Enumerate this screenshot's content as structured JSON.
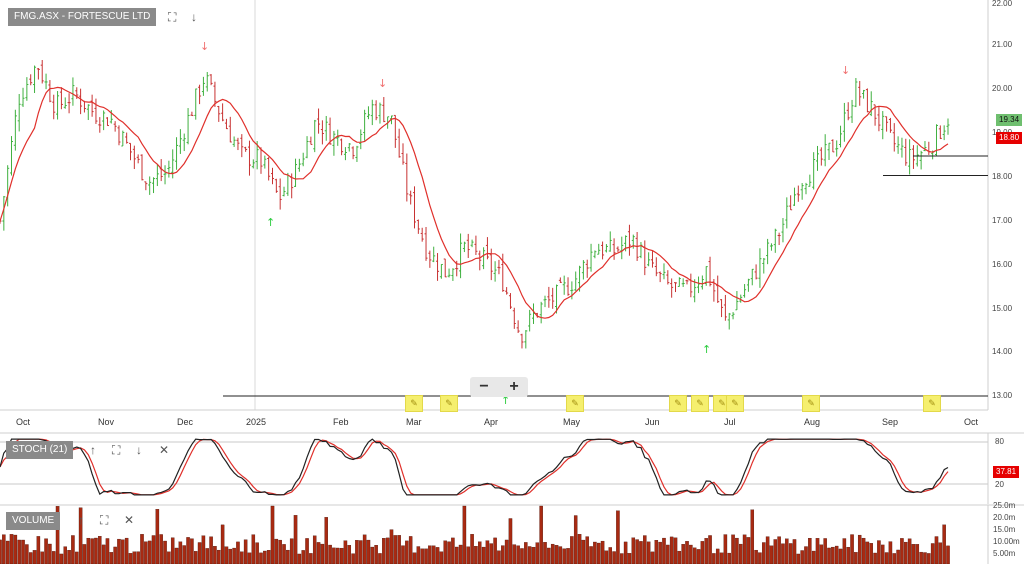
{
  "main_panel": {
    "label": "FMG.ASX - FORTESCUE LTD",
    "icons": [
      "expand-icon",
      "arrow-down-icon"
    ]
  },
  "stoch_panel": {
    "label": "STOCH (21)",
    "value_tag": "37.81",
    "icons": [
      "arrow-up-icon",
      "expand-icon",
      "arrow-down-icon",
      "close-icon"
    ],
    "axis_ticks": [
      "80",
      "20"
    ]
  },
  "volume_panel": {
    "label": "VOLUME",
    "icons": [
      "arrow-up-icon",
      "expand-icon",
      "close-icon"
    ],
    "axis_ticks": [
      "25.0m",
      "20.0m",
      "15.0m",
      "10.00m",
      "5.00m"
    ]
  },
  "price_axis": {
    "ticks": [
      "22.00",
      "21.00",
      "20.00",
      "19.00",
      "18.00",
      "17.00",
      "16.00",
      "15.00",
      "14.00",
      "13.00"
    ],
    "last_price": "19.34",
    "ma_price": "18.80"
  },
  "x_axis": {
    "months": [
      "Oct",
      "Nov",
      "Dec",
      "2025",
      "Feb",
      "Mar",
      "Apr",
      "May",
      "Jun",
      "Jul",
      "Aug",
      "Sep",
      "Oct"
    ]
  },
  "zoom": {
    "minus": "−",
    "plus": "+"
  },
  "colors": {
    "up_bar": "#3fb03f",
    "down_bar": "#c83232",
    "ma_line": "#e0302b",
    "volume_bar": "#a82a12",
    "stoch_k": "#222222",
    "stoch_d": "#e0302b",
    "last_tag": "#4caf50",
    "ma_tag": "#e60000"
  },
  "chart_data": {
    "type": "candlestick",
    "title": "FMG.ASX - FORTESCUE LTD",
    "ylim": [
      13,
      22
    ],
    "close_series": [
      {
        "date": "2024-09-26",
        "close": 17.0
      },
      {
        "date": "2024-10-01",
        "close": 19.8
      },
      {
        "date": "2024-10-07",
        "close": 20.6
      },
      {
        "date": "2024-10-14",
        "close": 19.6
      },
      {
        "date": "2024-10-21",
        "close": 19.9
      },
      {
        "date": "2024-10-28",
        "close": 19.5
      },
      {
        "date": "2024-11-04",
        "close": 19.3
      },
      {
        "date": "2024-11-11",
        "close": 18.6
      },
      {
        "date": "2024-11-18",
        "close": 17.9
      },
      {
        "date": "2024-11-25",
        "close": 18.1
      },
      {
        "date": "2024-12-02",
        "close": 19.2
      },
      {
        "date": "2024-12-09",
        "close": 20.3
      },
      {
        "date": "2024-12-16",
        "close": 19.3
      },
      {
        "date": "2024-12-23",
        "close": 18.5
      },
      {
        "date": "2024-12-30",
        "close": 18.4
      },
      {
        "date": "2025-01-06",
        "close": 17.5
      },
      {
        "date": "2025-01-13",
        "close": 18.2
      },
      {
        "date": "2025-01-20",
        "close": 19.3
      },
      {
        "date": "2025-01-27",
        "close": 18.9
      },
      {
        "date": "2025-02-03",
        "close": 18.7
      },
      {
        "date": "2025-02-10",
        "close": 19.6
      },
      {
        "date": "2025-02-17",
        "close": 19.4
      },
      {
        "date": "2025-02-24",
        "close": 17.5
      },
      {
        "date": "2025-03-03",
        "close": 16.3
      },
      {
        "date": "2025-03-10",
        "close": 15.8
      },
      {
        "date": "2025-03-17",
        "close": 16.4
      },
      {
        "date": "2025-03-24",
        "close": 16.1
      },
      {
        "date": "2025-03-31",
        "close": 15.7
      },
      {
        "date": "2025-04-07",
        "close": 14.4
      },
      {
        "date": "2025-04-14",
        "close": 15.0
      },
      {
        "date": "2025-04-21",
        "close": 15.3
      },
      {
        "date": "2025-04-28",
        "close": 15.7
      },
      {
        "date": "2025-05-05",
        "close": 16.4
      },
      {
        "date": "2025-05-12",
        "close": 16.3
      },
      {
        "date": "2025-05-19",
        "close": 16.6
      },
      {
        "date": "2025-05-26",
        "close": 15.9
      },
      {
        "date": "2025-06-02",
        "close": 15.5
      },
      {
        "date": "2025-06-09",
        "close": 15.4
      },
      {
        "date": "2025-06-16",
        "close": 15.9
      },
      {
        "date": "2025-06-23",
        "close": 14.7
      },
      {
        "date": "2025-06-30",
        "close": 15.4
      },
      {
        "date": "2025-07-07",
        "close": 16.1
      },
      {
        "date": "2025-07-14",
        "close": 16.8
      },
      {
        "date": "2025-07-21",
        "close": 17.9
      },
      {
        "date": "2025-07-28",
        "close": 18.3
      },
      {
        "date": "2025-08-04",
        "close": 18.8
      },
      {
        "date": "2025-08-11",
        "close": 20.0
      },
      {
        "date": "2025-08-18",
        "close": 19.5
      },
      {
        "date": "2025-08-25",
        "close": 18.8
      },
      {
        "date": "2025-09-01",
        "close": 18.4
      },
      {
        "date": "2025-09-08",
        "close": 18.7
      },
      {
        "date": "2025-09-15",
        "close": 19.34
      }
    ],
    "horizontal_lines": [
      13.0,
      18.0,
      18.45
    ]
  }
}
